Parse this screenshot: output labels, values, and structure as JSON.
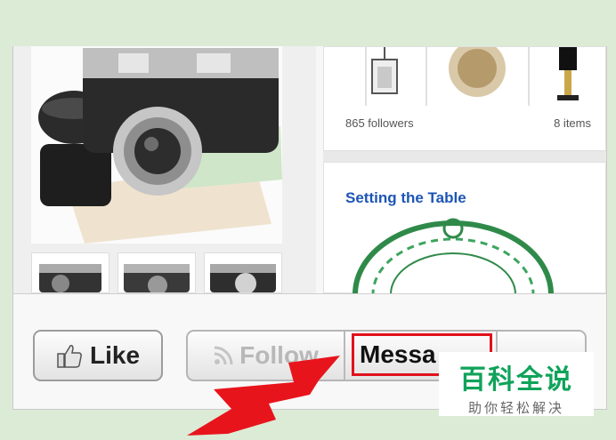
{
  "right_column": {
    "top_card": {
      "followers": "865 followers",
      "items": "8 items"
    },
    "bottom_card": {
      "title": "Setting the Table"
    }
  },
  "action_bar": {
    "like_label": "Like",
    "follow_label": "Follow",
    "message_label": "Messa"
  },
  "watermark": {
    "title": "百科全说",
    "subtitle": "助你轻松解决"
  },
  "colors": {
    "highlight": "#e0111b",
    "board_title": "#1d55b5",
    "watermark_green": "#0fa35a",
    "arrow": "#e8141c"
  }
}
